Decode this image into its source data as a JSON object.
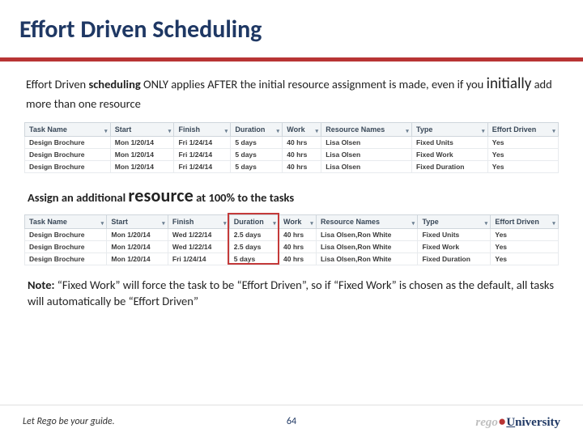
{
  "title": "Effort Driven Scheduling",
  "para1": {
    "pre": "Effort Driven ",
    "bold1": "scheduling",
    "mid1": " ONLY applies AFTER the initial resource assignment is made, even if you ",
    "big": "initially",
    "post": " add more than one resource"
  },
  "columns": [
    "Task Name",
    "Start",
    "Finish",
    "Duration",
    "Work",
    "Resource Names",
    "Type",
    "Effort Driven"
  ],
  "table1": [
    {
      "task": "Design Brochure",
      "start": "Mon 1/20/14",
      "finish": "Fri 1/24/14",
      "dur": "5 days",
      "work": "40 hrs",
      "res": "Lisa Olsen",
      "type": "Fixed Units",
      "eff": "Yes"
    },
    {
      "task": "Design Brochure",
      "start": "Mon 1/20/14",
      "finish": "Fri 1/24/14",
      "dur": "5 days",
      "work": "40 hrs",
      "res": "Lisa Olsen",
      "type": "Fixed Work",
      "eff": "Yes"
    },
    {
      "task": "Design Brochure",
      "start": "Mon 1/20/14",
      "finish": "Fri 1/24/14",
      "dur": "5 days",
      "work": "40 hrs",
      "res": "Lisa Olsen",
      "type": "Fixed Duration",
      "eff": "Yes"
    }
  ],
  "midtext": {
    "pre": "Assign an additional ",
    "big": "resource",
    "post": " at 100% to the tasks"
  },
  "table2": [
    {
      "task": "Design Brochure",
      "start": "Mon 1/20/14",
      "finish": "Wed 1/22/14",
      "dur": "2.5 days",
      "work": "40 hrs",
      "res": "Lisa Olsen,Ron White",
      "type": "Fixed Units",
      "eff": "Yes"
    },
    {
      "task": "Design Brochure",
      "start": "Mon 1/20/14",
      "finish": "Wed 1/22/14",
      "dur": "2.5 days",
      "work": "40 hrs",
      "res": "Lisa Olsen,Ron White",
      "type": "Fixed Work",
      "eff": "Yes"
    },
    {
      "task": "Design Brochure",
      "start": "Mon 1/20/14",
      "finish": "Fri 1/24/14",
      "dur": "5 days",
      "work": "40 hrs",
      "res": "Lisa Olsen,Ron White",
      "type": "Fixed Duration",
      "eff": "Yes"
    }
  ],
  "note": {
    "label": "Note:",
    "text": " “Fixed Work” will force the task to be “Effort Driven”, so if “Fixed Work” is chosen as the default, all tasks will automatically be “Effort Driven”"
  },
  "footer": {
    "tagline": "Let Rego be your guide.",
    "page": "64",
    "logo": {
      "rego": "rego",
      "uni_u": "U",
      "uni_rest": "niversity"
    }
  }
}
